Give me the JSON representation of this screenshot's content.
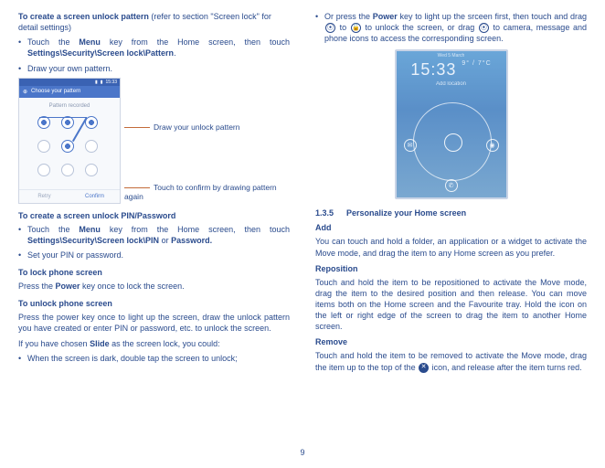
{
  "left": {
    "intro": {
      "bold": "To create a screen unlock pattern",
      "light": " (refer to section \"Screen lock\" for detail settings)"
    },
    "bullet1": {
      "pre": "Touch the ",
      "menu": "Menu",
      "mid": " key from the Home screen, then touch ",
      "path": "Settings\\Security\\Screen lock\\Pattern",
      "post": "."
    },
    "bullet2": "Draw your own pattern.",
    "mock": {
      "status_time": "15:33",
      "header": "Choose your pattern",
      "caption": "Pattern recorded",
      "retry": "Retry",
      "confirm": "Confirm"
    },
    "annot1": "Draw your unlock pattern",
    "annot2": "Touch to confirm by drawing pattern again",
    "heading2": "To create a screen unlock PIN/Password",
    "bullet3": {
      "pre": "Touch the ",
      "menu": "Menu",
      "mid": " key from the Home screen, then touch ",
      "path": "Settings\\Security\\Screen lock\\PIN ",
      "or": "or ",
      "pw": "Password."
    },
    "bullet4": "Set your PIN or password.",
    "heading3": "To lock phone screen",
    "para3a": "Press the ",
    "para3b": "Power",
    "para3c": " key once to lock the screen.",
    "heading4": "To unlock phone screen",
    "para4": "Press the power key once to light up the screen, draw the unlock pattern you have created or enter PIN or password, etc. to unlock the screen.",
    "para5a": "If you have chosen ",
    "para5b": "Slide",
    "para5c": " as the screen lock, you could:",
    "bullet5": "When the screen is dark, double tap the screen to unlock;"
  },
  "right": {
    "bullet1a": "Or press the ",
    "bullet1b": "Power",
    "bullet1c": " key to light up the srceen first, then touch and drag ",
    "bullet1d": " to ",
    "bullet1e": " to unlock the screen, or drag ",
    "bullet1f": " to camera, message and phone icons to access the corresponding screen.",
    "lockmock": {
      "status": "Wed   5 March",
      "time": "15:33",
      "unit": "9° / 7°C",
      "addloc": "Add location"
    },
    "sec_num": "1.3.5",
    "sec_title": "Personalize your Home screen",
    "add_h": "Add",
    "add_p": "You can touch and hold a folder, an application or a widget to activate the Move mode, and drag the item to any Home screen as you prefer.",
    "rep_h": "Reposition",
    "rep_p": "Touch and hold the item to be repositioned to activate the Move mode, drag the item to the desired position and then release. You can move items both on the Home screen and the Favourite tray. Hold the icon on the left or right edge of the screen to drag the item to another Home screen.",
    "rem_h": "Remove",
    "rem_p": "Touch and hold the item to be removed to activate the Move mode, drag the item up to the top of the ",
    "rem_p2": " icon, and release after the item turns red."
  },
  "pagenum": "9"
}
